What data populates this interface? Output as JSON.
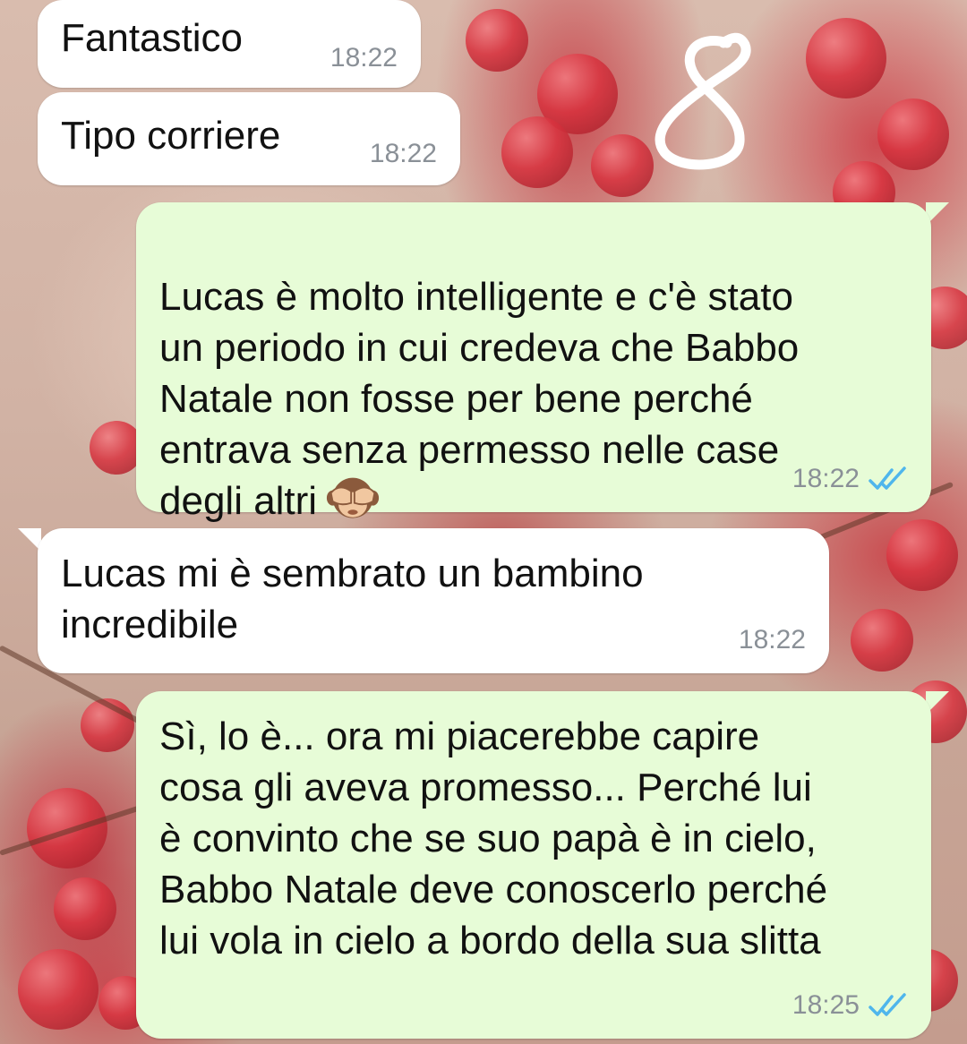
{
  "conversation": {
    "messages": [
      {
        "direction": "incoming",
        "text": "Fantastico",
        "time": "18:22"
      },
      {
        "direction": "incoming",
        "text": "Tipo corriere",
        "time": "18:22"
      },
      {
        "direction": "outgoing",
        "text": "Lucas è molto intelligente e c'è stato\nun periodo in cui credeva che Babbo\nNatale non fosse per bene perché\nentrava senza permesso nelle case\ndegli altri",
        "emoji": "see-no-evil-monkey",
        "time": "18:22",
        "status": "read"
      },
      {
        "direction": "incoming",
        "text": "Lucas mi è sembrato un bambino\nincredibile",
        "time": "18:22"
      },
      {
        "direction": "outgoing",
        "text": "Sì, lo è... ora mi piacerebbe capire\ncosa gli aveva promesso... Perché lui\nè convinto che se suo papà è in cielo,\nBabbo Natale deve conoscerlo perché\nlui vola in cielo a bordo della sua slitta",
        "time": "18:25",
        "status": "read"
      }
    ]
  },
  "colors": {
    "incoming_bubble": "#ffffff",
    "outgoing_bubble": "#e7fcd7",
    "read_ticks": "#4fb6ec",
    "timestamp": "#8a9097",
    "drawing_stroke": "#ffffff"
  },
  "icons": {
    "read_receipt": "double-check-icon",
    "doodle": "hand-drawn-figure-eight"
  }
}
